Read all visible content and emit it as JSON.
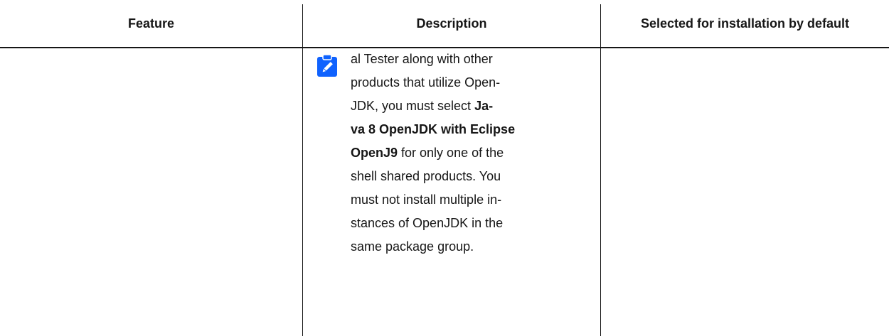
{
  "table": {
    "headers": [
      "Feature",
      "Description",
      "Selected for installation by default"
    ],
    "row": {
      "feature": "",
      "description_parts": [
        {
          "text": "al Tester along with other products that utilize Open-JDK, you must select ",
          "bold": false
        },
        {
          "text": "Ja-va 8 OpenJDK with Eclipse OpenJ9",
          "bold": true
        },
        {
          "text": " for only one of the shell shared products. You must not install multiple in-stances of OpenJDK in the same package group.",
          "bold": false
        }
      ],
      "description_lines": [
        [
          {
            "t": "al Tester along with other",
            "b": false
          }
        ],
        [
          {
            "t": "products that utilize Open-",
            "b": false
          }
        ],
        [
          {
            "t": "JDK, you must select ",
            "b": false
          },
          {
            "t": "Ja-",
            "b": true
          }
        ],
        [
          {
            "t": "va 8 OpenJDK with Eclipse",
            "b": true
          }
        ],
        [
          {
            "t": "OpenJ9",
            "b": true
          },
          {
            "t": " for only one of the",
            "b": false
          }
        ],
        [
          {
            "t": "shell shared products. You",
            "b": false
          }
        ],
        [
          {
            "t": "must not install multiple in-",
            "b": false
          }
        ],
        [
          {
            "t": "stances of OpenJDK in the",
            "b": false
          }
        ],
        [
          {
            "t": "same package group.",
            "b": false
          }
        ]
      ],
      "selected_default": ""
    },
    "note_icon": "note-pencil-icon",
    "colors": {
      "text": "#161616",
      "icon": "#0f62fe",
      "rule": "#161616"
    }
  }
}
